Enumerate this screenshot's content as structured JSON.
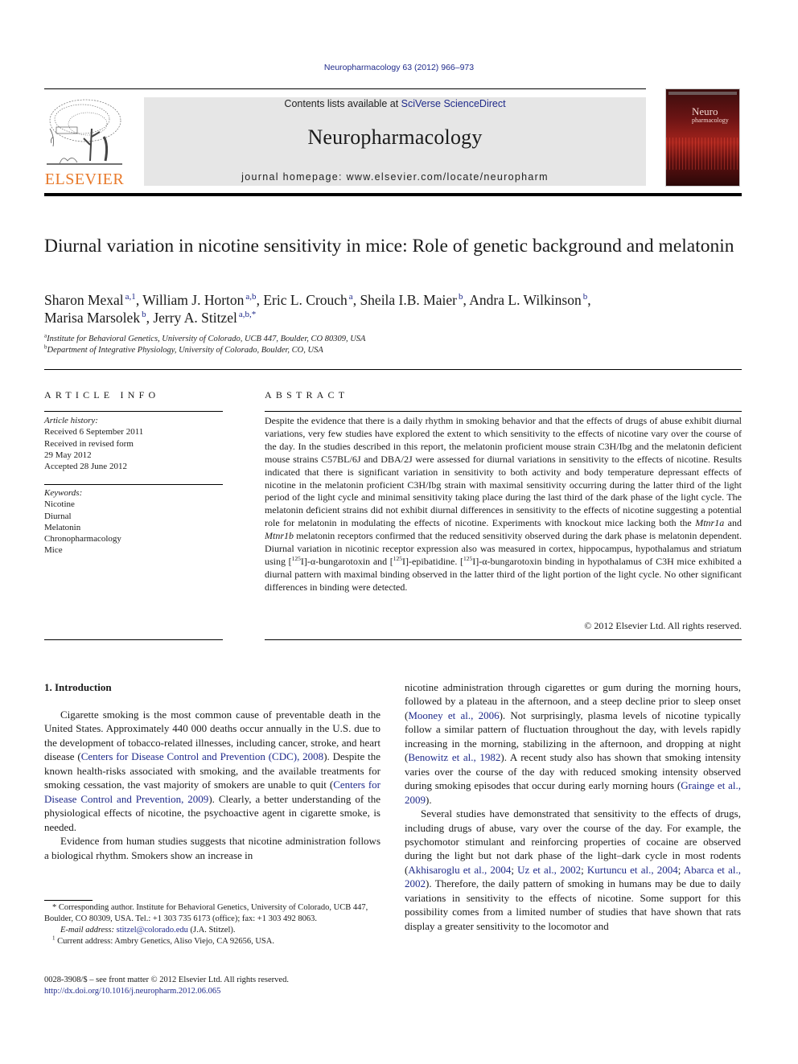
{
  "header": {
    "journal_ref": "Neuropharmacology 63 (2012) 966–973",
    "contents_prefix": "Contents lists available at ",
    "contents_link": "SciVerse ScienceDirect",
    "journal_title": "Neuropharmacology",
    "homepage": "journal homepage: www.elsevier.com/locate/neuropharm",
    "publisher_logo_text": "ELSEVIER",
    "cover_title_1": "Neuro",
    "cover_title_2": "pharmacology",
    "colors": {
      "link": "#1f2a8a",
      "elsevier_orange": "#e8792a",
      "masthead_bg": "#e6e6e6",
      "cover_red": "#a3231c"
    }
  },
  "article": {
    "title": "Diurnal variation in nicotine sensitivity in mice: Role of genetic background and melatonin",
    "authors": [
      {
        "name": "Sharon Mexal",
        "sup": "a,1",
        "sep": ", "
      },
      {
        "name": "William J. Horton",
        "sup": "a,b",
        "sep": ", "
      },
      {
        "name": "Eric L. Crouch",
        "sup": "a",
        "sep": ", "
      },
      {
        "name": "Sheila I.B. Maier",
        "sup": "b",
        "sep": ", "
      },
      {
        "name": "Andra L. Wilkinson",
        "sup": "b",
        "sep": ","
      },
      {
        "name": "Marisa Marsolek",
        "sup": "b",
        "sep": ", "
      },
      {
        "name": "Jerry A. Stitzel",
        "sup": "a,b,*",
        "sep": ""
      }
    ],
    "affiliations": [
      {
        "mark": "a",
        "text": "Institute for Behavioral Genetics, University of Colorado, UCB 447, Boulder, CO 80309, USA"
      },
      {
        "mark": "b",
        "text": "Department of Integrative Physiology, University of Colorado, Boulder, CO, USA"
      }
    ]
  },
  "article_info": {
    "label": "ARTICLE INFO",
    "history_header": "Article history:",
    "history": [
      "Received 6 September 2011",
      "Received in revised form",
      "29 May 2012",
      "Accepted 28 June 2012"
    ],
    "keywords_header": "Keywords:",
    "keywords": [
      "Nicotine",
      "Diurnal",
      "Melatonin",
      "Chronopharmacology",
      "Mice"
    ]
  },
  "abstract": {
    "label": "ABSTRACT",
    "part1": "Despite the evidence that there is a daily rhythm in smoking behavior and that the effects of drugs of abuse exhibit diurnal variations, very few studies have explored the extent to which sensitivity to the effects of nicotine vary over the course of the day. In the studies described in this report, the melatonin proficient mouse strain C3H/Ibg and the melatonin deficient mouse strains C57BL/6J and DBA/2J were assessed for diurnal variations in sensitivity to the effects of nicotine. Results indicated that there is significant variation in sensitivity to both activity and body temperature depressant effects of nicotine in the melatonin proficient C3H/Ibg strain with maximal sensitivity occurring during the latter third of the light period of the light cycle and minimal sensitivity taking place during the last third of the dark phase of the light cycle. The melatonin deficient strains did not exhibit diurnal differences in sensitivity to the effects of nicotine suggesting a potential role for melatonin in modulating the effects of nicotine. Experiments with knockout mice lacking both the ",
    "gene1": "Mtnr1a",
    "and": " and ",
    "gene2": "Mtnr1b",
    "part2": " melatonin receptors confirmed that the reduced sensitivity observed during the dark phase is melatonin dependent. Diurnal variation in nicotinic receptor expression also was measured in cortex, hippocampus, hypothalamus and striatum using [",
    "iso": "125",
    "part3": "I]-α-bungarotoxin and [",
    "part4": "I]-epibatidine. [",
    "part5": "I]-α-bungarotoxin binding in hypothalamus of C3H mice exhibited a diurnal pattern with maximal binding observed in the latter third of the light portion of the light cycle. No other significant differences in binding were detected.",
    "copyright": "© 2012 Elsevier Ltd. All rights reserved."
  },
  "intro": {
    "heading": "1.  Introduction",
    "p1_a": "Cigarette smoking is the most common cause of preventable death in the United States. Approximately 440 000 deaths occur annually in the U.S. due to the development of tobacco-related illnesses, including cancer, stroke, and heart disease (",
    "p1_link1": "Centers for Disease Control and Prevention (CDC), 2008",
    "p1_b": "). Despite the known health-risks associated with smoking, and the available treatments for smoking cessation, the vast majority of smokers are unable to quit (",
    "p1_link2": "Centers for Disease Control and Prevention, 2009",
    "p1_c": "). Clearly, a better understanding of the physiological effects of nicotine, the psychoactive agent in cigarette smoke, is needed.",
    "p2_a": "Evidence from human studies suggests that nicotine administration follows a biological rhythm. Smokers show an increase in ",
    "p2_b": "nicotine administration through cigarettes or gum during the morning hours, followed by a plateau in the afternoon, and a steep decline prior to sleep onset (",
    "p2_link1": "Mooney et al., 2006",
    "p2_c": "). Not surprisingly, plasma levels of nicotine typically follow a similar pattern of fluctuation throughout the day, with levels rapidly increasing in the morning, stabilizing in the afternoon, and dropping at night (",
    "p2_link2": "Benowitz et al., 1982",
    "p2_d": "). A recent study also has shown that smoking intensity varies over the course of the day with reduced smoking intensity observed during smoking episodes that occur during early morning hours (",
    "p2_link3": "Grainge et al., 2009",
    "p2_e": ").",
    "p3_a": "Several studies have demonstrated that sensitivity to the effects of drugs, including drugs of abuse, vary over the course of the day. For example, the psychomotor stimulant and reinforcing properties of cocaine are observed during the light but not dark phase of the light–dark cycle in most rodents (",
    "p3_link1": "Akhisaroglu et al., 2004",
    "p3_sep1": "; ",
    "p3_link2": "Uz et al., 2002",
    "p3_sep2": "; ",
    "p3_link3": "Kurtuncu et al., 2004",
    "p3_sep3": "; ",
    "p3_link4": "Abarca et al., 2002",
    "p3_b": "). Therefore, the daily pattern of smoking in humans may be due to daily variations in sensitivity to the effects of nicotine. Some support for this possibility comes from a limited number of studies that have shown that rats display a greater sensitivity to the locomotor and"
  },
  "footnotes": {
    "corresponding": "* Corresponding author. Institute for Behavioral Genetics, University of Colorado, UCB 447, Boulder, CO 80309, USA. Tel.: +1 303 735 6173 (office); fax: +1 303 492 8063.",
    "email_label": "E-mail address: ",
    "email": "stitzel@colorado.edu",
    "email_suffix": " (J.A. Stitzel).",
    "current_mark": "1",
    "current_address": " Current address: Ambry Genetics, Aliso Viejo, CA 92656, USA."
  },
  "front_matter": {
    "issn_line": "0028-3908/$ – see front matter © 2012 Elsevier Ltd. All rights reserved.",
    "doi": "http://dx.doi.org/10.1016/j.neuropharm.2012.06.065"
  }
}
